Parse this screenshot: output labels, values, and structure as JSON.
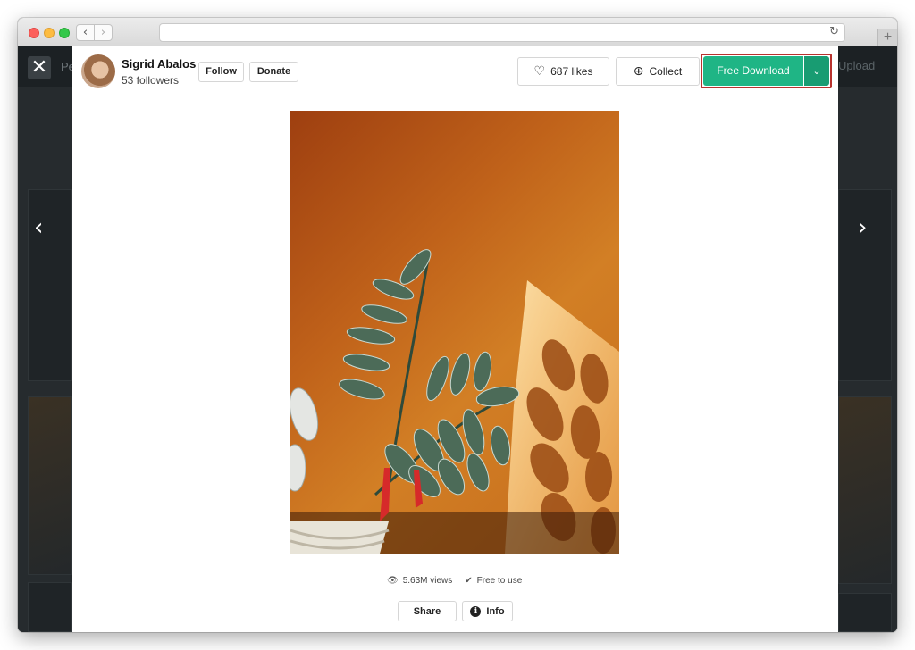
{
  "browser": {
    "back_glyph": "‹",
    "forward_glyph": "›",
    "reload_glyph": "↻",
    "newtab_glyph": "+"
  },
  "background": {
    "left_text": "Pe",
    "upload_text": "Upload",
    "close_glyph": "✕",
    "prev_glyph": "‹",
    "next_glyph": "›"
  },
  "author": {
    "name": "Sigrid Abalos",
    "followers": "53 followers"
  },
  "actions": {
    "follow_label": "Follow",
    "donate_label": "Donate",
    "likes_label": "687 likes",
    "collect_label": "Collect",
    "download_label": "Free Download"
  },
  "icons": {
    "heart": "♡",
    "plus_circle": "⊕",
    "chevron_down": "⌄",
    "eye": "👁",
    "check_circle": "✔",
    "info": "i"
  },
  "stats": {
    "views": "5.63M views",
    "license": "Free to use"
  },
  "footer": {
    "share_label": "Share",
    "info_label": "Info"
  },
  "colors": {
    "download_green": "#1fb585",
    "download_green_dark": "#189c72",
    "highlight_red": "#b8322e",
    "photo_orange": "#d27f25"
  }
}
